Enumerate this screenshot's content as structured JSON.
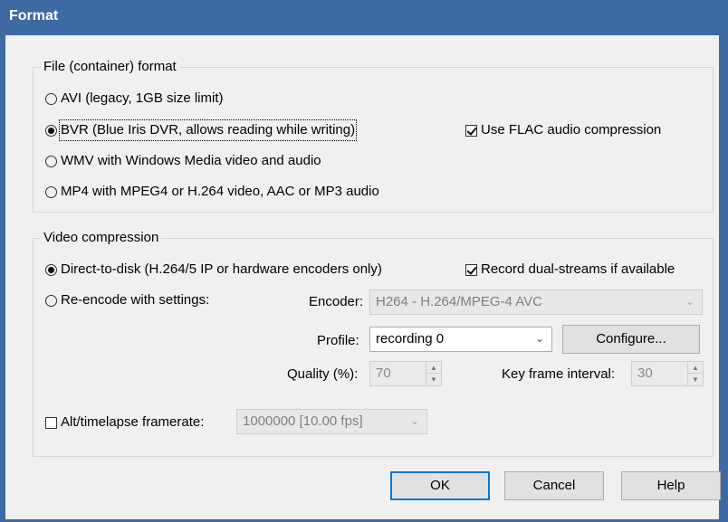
{
  "window": {
    "title": "Format"
  },
  "file_format": {
    "group_title": "File (container) format",
    "options": [
      {
        "label": "AVI (legacy, 1GB size limit)",
        "selected": false
      },
      {
        "label": "BVR (Blue Iris DVR, allows reading while writing)",
        "selected": true
      },
      {
        "label": "WMV with Windows Media video and audio",
        "selected": false
      },
      {
        "label": "MP4 with MPEG4 or H.264 video, AAC or MP3 audio",
        "selected": false
      }
    ],
    "flac_label": "Use FLAC audio compression",
    "flac_checked": true
  },
  "video_compression": {
    "group_title": "Video compression",
    "direct_label": "Direct-to-disk (H.264/5 IP or hardware encoders only)",
    "direct_selected": true,
    "dual_label": "Record dual-streams if available",
    "dual_checked": true,
    "reencode_label": "Re-encode with settings:",
    "reencode_selected": false,
    "encoder_label": "Encoder:",
    "encoder_value": "H264 - H.264/MPEG-4 AVC",
    "profile_label": "Profile:",
    "profile_value": "recording 0",
    "configure_label": "Configure...",
    "quality_label": "Quality (%):",
    "quality_value": "70",
    "keyframe_label": "Key frame interval:",
    "keyframe_value": "30",
    "alt_label": "Alt/timelapse framerate:",
    "alt_checked": false,
    "alt_value": "1000000 [10.00 fps]"
  },
  "buttons": {
    "ok": "OK",
    "cancel": "Cancel",
    "help": "Help"
  }
}
